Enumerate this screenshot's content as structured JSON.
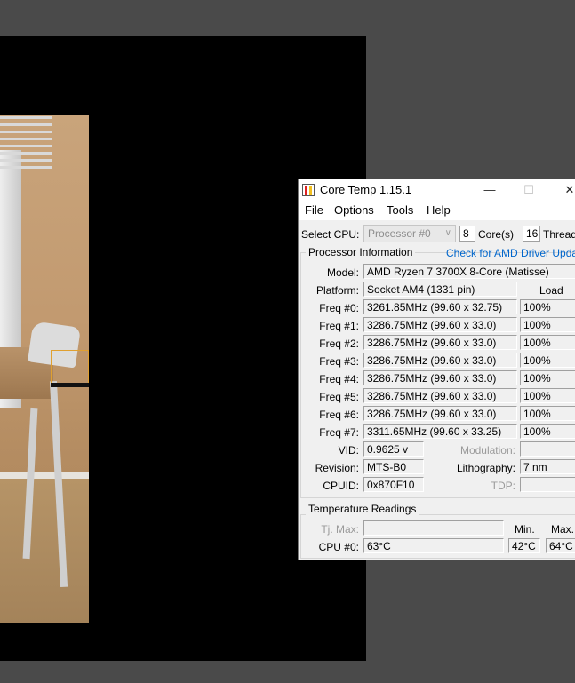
{
  "window": {
    "title": "Core Temp 1.15.1",
    "minimize": "—",
    "maximize": "☐",
    "close": "✕"
  },
  "menu": [
    "File",
    "Options",
    "Tools",
    "Help"
  ],
  "cpu_select": {
    "label": "Select CPU:",
    "value": "Processor #0",
    "cores_value": "8",
    "cores_label": "Core(s)",
    "threads_value": "16",
    "threads_label": "Thread("
  },
  "processor_info": {
    "legend": "Processor Information",
    "driver_link": "Check for AMD Driver Updates",
    "model_label": "Model:",
    "model": "AMD Ryzen 7 3700X 8-Core (Matisse)",
    "platform_label": "Platform:",
    "platform": "Socket AM4 (1331 pin)",
    "load_header": "Load",
    "freqs": [
      {
        "label": "Freq #0:",
        "value": "3261.85MHz (99.60 x 32.75)",
        "load": "100%"
      },
      {
        "label": "Freq #1:",
        "value": "3286.75MHz (99.60 x 33.0)",
        "load": "100%"
      },
      {
        "label": "Freq #2:",
        "value": "3286.75MHz (99.60 x 33.0)",
        "load": "100%"
      },
      {
        "label": "Freq #3:",
        "value": "3286.75MHz (99.60 x 33.0)",
        "load": "100%"
      },
      {
        "label": "Freq #4:",
        "value": "3286.75MHz (99.60 x 33.0)",
        "load": "100%"
      },
      {
        "label": "Freq #5:",
        "value": "3286.75MHz (99.60 x 33.0)",
        "load": "100%"
      },
      {
        "label": "Freq #6:",
        "value": "3286.75MHz (99.60 x 33.0)",
        "load": "100%"
      },
      {
        "label": "Freq #7:",
        "value": "3311.65MHz (99.60 x 33.25)",
        "load": "100%"
      }
    ],
    "vid_label": "VID:",
    "vid": "0.9625 v",
    "modulation_label": "Modulation:",
    "revision_label": "Revision:",
    "revision": "MTS-B0",
    "lithography_label": "Lithography:",
    "lithography": "7 nm",
    "cpuid_label": "CPUID:",
    "cpuid": "0x870F10",
    "tdp_label": "TDP:"
  },
  "temperature": {
    "legend": "Temperature Readings",
    "tjmax_label": "Tj. Max:",
    "min_header": "Min.",
    "max_header": "Max.",
    "cpu_label": "CPU #0:",
    "cpu_temp": "63°C",
    "min": "42°C",
    "max": "64°C"
  },
  "colors": {
    "desktop": "#4a4a4a",
    "canvas": "#000000",
    "link": "#0066cc",
    "selection": "#e0a030"
  }
}
